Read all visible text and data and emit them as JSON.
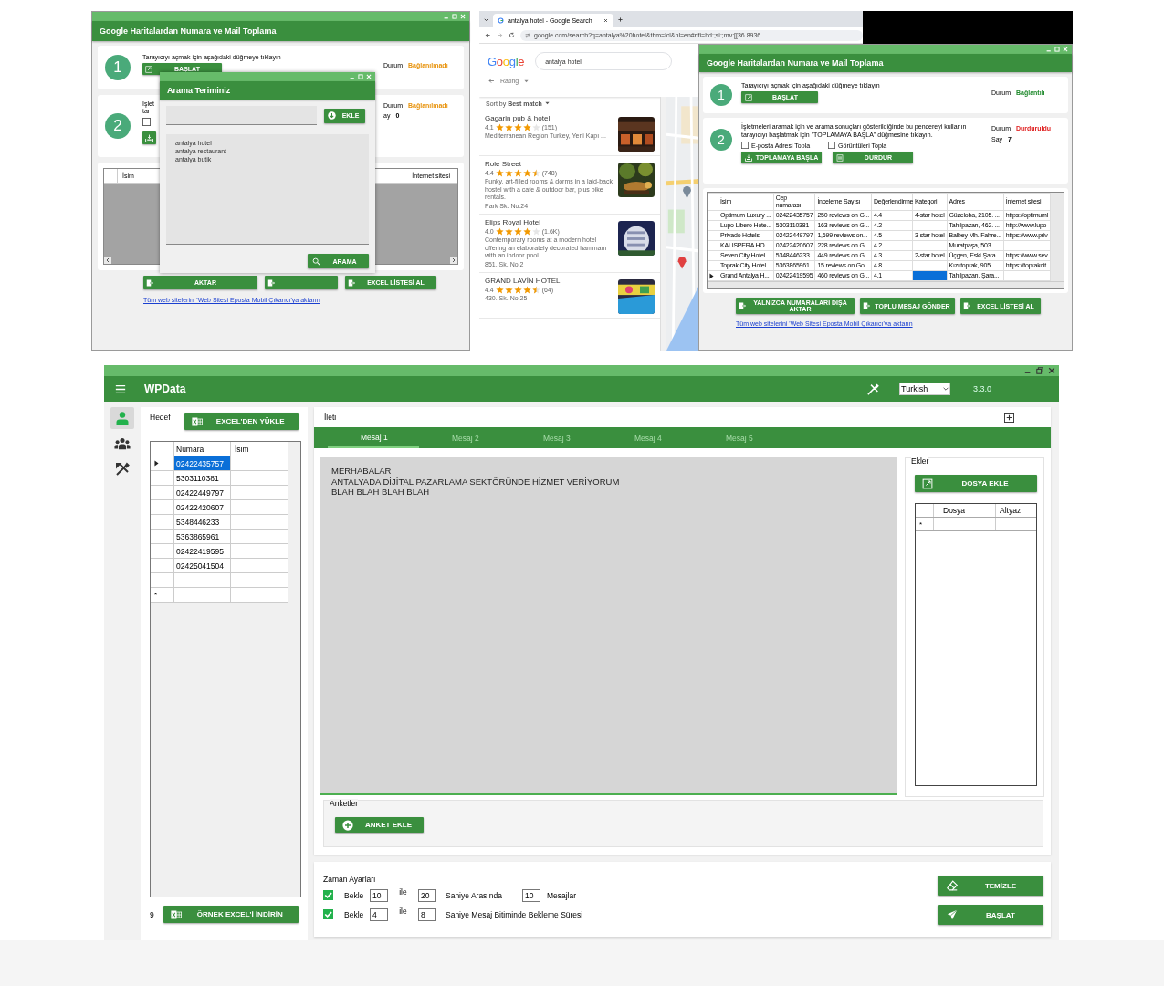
{
  "collector_back": {
    "title": "Google Haritalardan Numara ve Mail Toplama",
    "step1": {
      "number": "1",
      "text": "Tarayıcıyı açmak için aşağıdaki düğmeye tıklayın",
      "button": "BAŞLAT",
      "status_label": "Durum",
      "status": {
        "text": "Bağlanılmadı",
        "kind": "pending"
      }
    },
    "step2": {
      "number": "2",
      "text_lines": [
        "İşlet",
        "tar"
      ],
      "checked": false,
      "status_label": "Durum",
      "status": {
        "text": "Bağlanılmadı",
        "kind": "pending"
      },
      "count_label": "ay",
      "count": "0"
    },
    "table": {
      "columns": [
        "İsim",
        "İnternet sitesi"
      ]
    },
    "buttons": [
      "AKTAR",
      "EXCEL LİSTESİ AL"
    ],
    "link": "Tüm web sitelerini 'Web Sitesi Eposta Mobil Çıkarıcı'ya aktarın"
  },
  "search_dialog": {
    "title": "Arama Teriminiz",
    "add_button": "EKLE",
    "terms": [
      "antalya hotel",
      "antalya restaurant",
      "antalya butik"
    ],
    "search_button": "ARAMA"
  },
  "browser": {
    "tab_title": "antalya hotel - Google Search",
    "url": "google.com/search?q=antalya%20hotel&tbm=lcl&hl=en#rlfi=hd:;si:;mv:[[36.8936",
    "logo": "Google",
    "query": "antalya hotel",
    "filter": "Rating",
    "sort_label": "Sort by",
    "sort_value": "Best match",
    "results": [
      {
        "name": "Gagarin pub & hotel",
        "rating": "4.1",
        "stars": 4,
        "reviews": "(151)",
        "details": [
          "Mediterranean Region Turkey, Yeni Kapı ..."
        ]
      },
      {
        "name": "Role Street",
        "rating": "4.4",
        "stars": 4.5,
        "reviews": "(748)",
        "details": [
          "Funky, art-filled rooms & dorms in a laid-back hostel with a cafe & outdoor bar, plus bike rentals.",
          "Park Sk. No:24"
        ]
      },
      {
        "name": "Elips Royal Hotel",
        "rating": "4.0",
        "stars": 4,
        "reviews": "(1.6K)",
        "details": [
          "Contemporary rooms at a modern hotel offering an elaborately decorated hammam with an indoor pool.",
          "851. Sk. No:2"
        ]
      },
      {
        "name": "GRAND LAVİN HOTEL",
        "rating": "4.4",
        "stars": 4.5,
        "reviews": "(64)",
        "details": [
          "430. Sk. No:25"
        ]
      }
    ]
  },
  "collector_front": {
    "title": "Google Haritalardan Numara ve Mail Toplama",
    "step1": {
      "number": "1",
      "text": "Tarayıcıyı açmak için aşağıdaki düğmeye tıklayın",
      "button": "BAŞLAT",
      "status_label": "Durum",
      "status": {
        "text": "Bağlantılı",
        "kind": "connected"
      }
    },
    "step2": {
      "number": "2",
      "text": "İşletmeleri aramak için ve arama sonuçları gösterildiğinde bu pencereyi kullanın tarayıcıyı başlatmak için \"TOPLAMAYA BAŞLA\" düğmesine tıklayın.",
      "status_label": "Durum",
      "status": {
        "text": "Durduruldu",
        "kind": "stopped"
      },
      "count_label": "Say",
      "count": "7",
      "options": [
        {
          "label": "E-posta Adresi Topla",
          "checked": false
        },
        {
          "label": "Görüntüleri Topla",
          "checked": false
        }
      ],
      "buttons": [
        "TOPLAMAYA BAŞLA",
        "DURDUR"
      ]
    },
    "table": {
      "columns": [
        "İsim",
        "Cep numarası",
        "İnceleme Sayısı",
        "Değerlendirme",
        "Kategori",
        "Adres",
        "İnternet sitesi"
      ],
      "rows": [
        {
          "current": false,
          "cells": [
            {
              "text": "Optimum Luxury ...",
              "selected": false
            },
            {
              "text": "02422435757",
              "selected": false
            },
            {
              "text": "250 reviews on G...",
              "selected": false
            },
            {
              "text": "4.4",
              "selected": false
            },
            {
              "text": "4-star hotel",
              "selected": false
            },
            {
              "text": "Güzeloba, 2105. ...",
              "selected": false
            },
            {
              "text": "https://optimuml",
              "selected": false
            }
          ]
        },
        {
          "current": false,
          "cells": [
            {
              "text": "Lupo Libero Hote...",
              "selected": false
            },
            {
              "text": "5303110381",
              "selected": false
            },
            {
              "text": "163 reviews on G...",
              "selected": false
            },
            {
              "text": "4.2",
              "selected": false
            },
            {
              "selected": false
            },
            {
              "text": "Tahılpazarı, 462. ...",
              "selected": false
            },
            {
              "text": "http://www.lupo",
              "selected": false
            }
          ]
        },
        {
          "current": false,
          "cells": [
            {
              "text": "Privado Hotels",
              "selected": false
            },
            {
              "text": "02422449797",
              "selected": false
            },
            {
              "text": "1,699 reviews on...",
              "selected": false
            },
            {
              "text": "4.5",
              "selected": false
            },
            {
              "text": "3-star hotel",
              "selected": false
            },
            {
              "text": "Balbey Mh. Fahre...",
              "selected": false
            },
            {
              "text": "https://www.priv",
              "selected": false
            }
          ]
        },
        {
          "current": false,
          "cells": [
            {
              "text": "KALISPERA HO...",
              "selected": false
            },
            {
              "text": "02422420607",
              "selected": false
            },
            {
              "text": "228 reviews on G...",
              "selected": false
            },
            {
              "text": "4.2",
              "selected": false
            },
            {
              "selected": false
            },
            {
              "text": "Muratpaşa, 503. ...",
              "selected": false
            },
            {
              "selected": false
            }
          ]
        },
        {
          "current": false,
          "cells": [
            {
              "text": "Seven City Hotel",
              "selected": false
            },
            {
              "text": "5348446233",
              "selected": false
            },
            {
              "text": "449 reviews on G...",
              "selected": false
            },
            {
              "text": "4.3",
              "selected": false
            },
            {
              "text": "2-star hotel",
              "selected": false
            },
            {
              "text": "Üçgen, Eski Şara...",
              "selected": false
            },
            {
              "text": "https://www.sev",
              "selected": false
            }
          ]
        },
        {
          "current": false,
          "cells": [
            {
              "text": "Toprak City Hotel...",
              "selected": false
            },
            {
              "text": "5363865961",
              "selected": false
            },
            {
              "text": "15 reviews on Go...",
              "selected": false
            },
            {
              "text": "4.8",
              "selected": false
            },
            {
              "selected": false
            },
            {
              "text": "Kızıltoprak, 905. ...",
              "selected": false
            },
            {
              "text": "https://toprakcit",
              "selected": false
            }
          ]
        },
        {
          "current": true,
          "cells": [
            {
              "text": "Grand Antalya H...",
              "selected": false
            },
            {
              "text": "02422419595",
              "selected": false
            },
            {
              "text": "460 reviews on G...",
              "selected": false
            },
            {
              "text": "4.1",
              "selected": false
            },
            {
              "selected": true
            },
            {
              "text": "Tahılpazarı, Şara...",
              "selected": false
            },
            {
              "selected": false
            }
          ]
        }
      ]
    },
    "buttons": [
      "YALNIZCA NUMARALARI DIŞA AKTAR",
      "TOPLU MESAJ GÖNDER",
      "EXCEL LİSTESİ AL"
    ],
    "link": "Tüm web sitelerini 'Web Sitesi Eposta Mobil Çıkarıcı'ya aktarın"
  },
  "wpdata": {
    "app_name": "WPData",
    "language": "Turkish",
    "version": "3.3.0",
    "sidebar": [
      {
        "kind": "person",
        "selected": true
      },
      {
        "kind": "group",
        "selected": false
      },
      {
        "kind": "tools",
        "selected": false
      }
    ],
    "target": {
      "label": "Hedef",
      "load_button": "EXCEL'DEN YÜKLE",
      "columns": [
        "Numara",
        "İsim"
      ],
      "rows": [
        {
          "number": "02422435757",
          "selected": true
        },
        {
          "number": "5303110381",
          "selected": false
        },
        {
          "number": "02422449797",
          "selected": false
        },
        {
          "number": "02422420607",
          "selected": false
        },
        {
          "number": "5348446233",
          "selected": false
        },
        {
          "number": "5363865961",
          "selected": false
        },
        {
          "number": "02422419595",
          "selected": false
        },
        {
          "number": "02425041504",
          "selected": false
        }
      ],
      "new_row_marker": "*",
      "count": "9",
      "sample_button": "ÖRNEK EXCEL'İ İNDİRİN"
    },
    "message": {
      "label": "İleti",
      "tabs": [
        {
          "label": "Mesaj 1",
          "selected": true
        },
        {
          "label": "Mesaj 2",
          "selected": false
        },
        {
          "label": "Mesaj 3",
          "selected": false
        },
        {
          "label": "Mesaj 4",
          "selected": false
        },
        {
          "label": "Mesaj 5",
          "selected": false
        }
      ],
      "text": "MERHABALAR\nANTALYADA DİJİTAL PAZARLAMA SEKTÖRÜNDE HİZMET VERİYORUM\nBLAH BLAH BLAH BLAH",
      "attachments": {
        "label": "Ekler",
        "button": "DOSYA EKLE",
        "columns": [
          "Dosya",
          "Altyazı"
        ],
        "new_row_marker": "*"
      },
      "polls": {
        "label": "Anketler",
        "button": "ANKET EKLE"
      }
    },
    "timing": {
      "label": "Zaman Ayarları",
      "rows": [
        {
          "checked": true,
          "wait_label": "Bekle",
          "from": "10",
          "to_label": "ile",
          "to": "20",
          "unit_label": "Saniye Arasında",
          "extra_value": "10",
          "extra_label": "Mesajlar"
        },
        {
          "checked": true,
          "wait_label": "Bekle",
          "from": "4",
          "to_label": "ile",
          "to": "8",
          "unit_label": "Saniye Mesaj Bitiminde Bekleme Süresi"
        }
      ],
      "clear_button": "TEMİZLE",
      "start_button": "BAŞLAT"
    }
  }
}
